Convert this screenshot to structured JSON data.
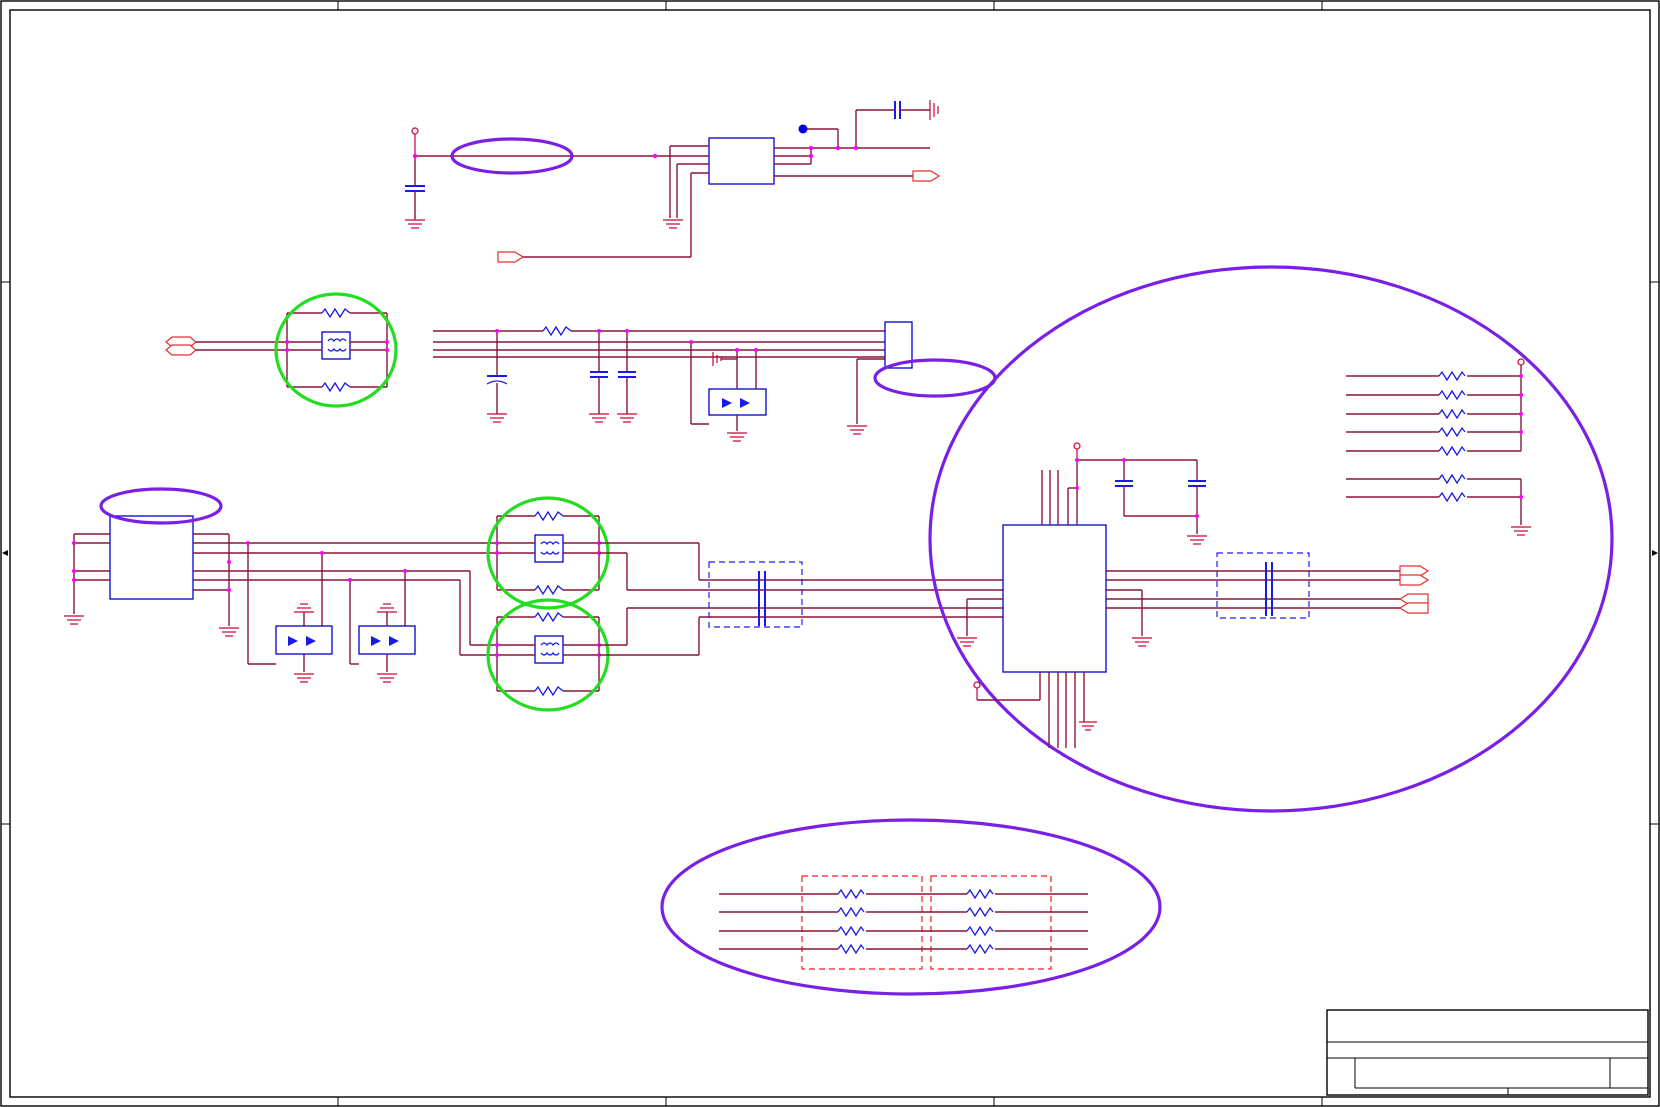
{
  "sheet": {
    "colors": {
      "border": "#000000",
      "net_wire": "#8a1538",
      "junction": "#ff00ff",
      "component_body": "#0000cc",
      "power_symbol": "#cc0033",
      "port": "#e62e2e",
      "review_mark_violet": "#7a1fe6",
      "review_mark_green": "#22dd22"
    },
    "icons": {
      "ground": "ground-icon",
      "power_rail": "power-rail-icon",
      "capacitor": "capacitor-icon",
      "resistor": "resistor-icon",
      "common_mode_choke": "common-mode-choke-icon",
      "tvs_diode": "tvs-diode-icon",
      "port": "net-port-icon"
    },
    "title_block": {
      "title": "",
      "sheet_number": ""
    }
  }
}
